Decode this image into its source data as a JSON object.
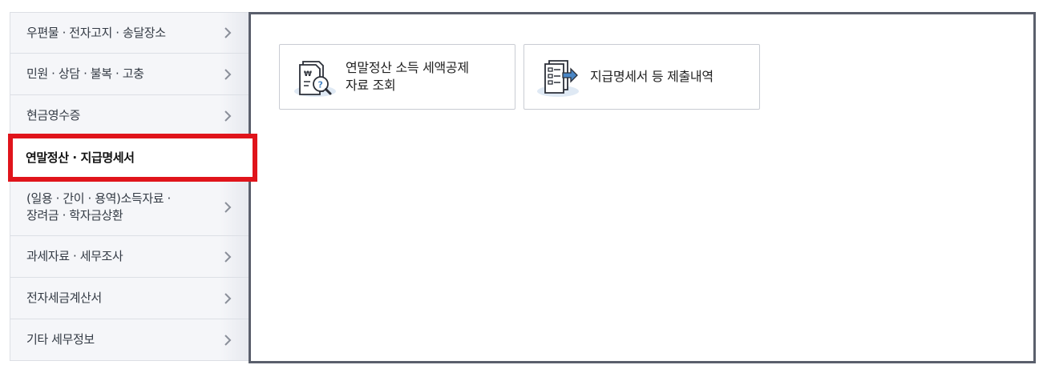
{
  "sidemenu": {
    "items": [
      {
        "label": "우편물 · 전자고지 · 송달장소",
        "active": false
      },
      {
        "label": "민원 · 상담 · 불복 · 고충",
        "active": false
      },
      {
        "label": "현금영수증",
        "active": false
      },
      {
        "label": "연말정산 · 지급명세서",
        "active": true
      },
      {
        "label": "(일용 · 간이 · 용역)소득자료 ·\n장려금 · 학자금상환",
        "active": false
      },
      {
        "label": "과세자료 · 세무조사",
        "active": false
      },
      {
        "label": "전자세금계산서",
        "active": false
      },
      {
        "label": "기타 세무정보",
        "active": false
      }
    ],
    "arrow_icon": "chevron-right-icon"
  },
  "content": {
    "cards": [
      {
        "label": "연말정산 소득 세액공제\n자료 조회",
        "icon": "tax-document-search-icon"
      },
      {
        "label": "지급명세서 등 제출내역",
        "icon": "document-submit-icon"
      }
    ]
  },
  "colors": {
    "menu_bg": "#f5f6f9",
    "menu_border": "#dcdfe5",
    "active_border": "#e0141b",
    "panel_border": "#5a5f6c",
    "icon_blue": "#4a86c5",
    "icon_bg": "#dfe9f4"
  }
}
